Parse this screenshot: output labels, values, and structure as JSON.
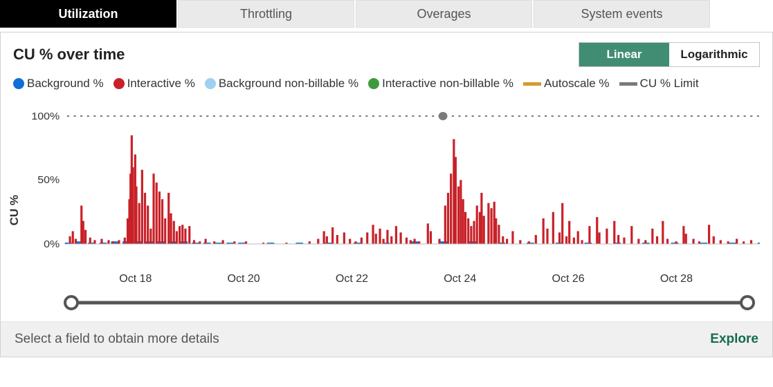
{
  "tabs": [
    {
      "label": "Utilization",
      "active": true
    },
    {
      "label": "Throttling",
      "active": false
    },
    {
      "label": "Overages",
      "active": false
    },
    {
      "label": "System events",
      "active": false
    }
  ],
  "chart_title": "CU % over time",
  "scale_toggle": {
    "linear": "Linear",
    "log": "Logarithmic",
    "active": "linear"
  },
  "legend": [
    {
      "name": "Background %",
      "type": "dot",
      "color": "#0f6fd6"
    },
    {
      "name": "Interactive %",
      "type": "dot",
      "color": "#c82128"
    },
    {
      "name": "Background non-billable %",
      "type": "dot",
      "color": "#9fd0f2"
    },
    {
      "name": "Interactive non-billable %",
      "type": "dot",
      "color": "#3f9a3f"
    },
    {
      "name": "Autoscale %",
      "type": "line",
      "color": "#d69a2f"
    },
    {
      "name": "CU % Limit",
      "type": "line",
      "color": "#7a7a7a"
    }
  ],
  "yaxis_label": "CU %",
  "yticks": [
    "0%",
    "50%",
    "100%"
  ],
  "xticks": [
    "Oct 18",
    "Oct 20",
    "Oct 22",
    "Oct 24",
    "Oct 26",
    "Oct 28"
  ],
  "footer_text": "Select a field to obtain more details",
  "explore_label": "Explore",
  "chart_data": {
    "type": "bar",
    "title": "CU % over time",
    "xlabel": "",
    "ylabel": "CU %",
    "ylim": [
      0,
      100
    ],
    "cu_limit": 100,
    "x_range": [
      "Oct 17",
      "Oct 29"
    ],
    "xticks": [
      "Oct 18",
      "Oct 20",
      "Oct 22",
      "Oct 24",
      "Oct 26",
      "Oct 28"
    ],
    "series": [
      {
        "name": "Background %",
        "color": "#0f6fd6",
        "note": "near-zero baseline across full range, ≤2%",
        "interactive_values": [
          {
            "x": 17.0,
            "v": 1
          },
          {
            "x": 17.2,
            "v": 2
          },
          {
            "x": 17.4,
            "v": 1
          },
          {
            "x": 17.6,
            "v": 1
          },
          {
            "x": 17.8,
            "v": 2
          },
          {
            "x": 18.0,
            "v": 2
          },
          {
            "x": 18.2,
            "v": 2
          },
          {
            "x": 18.4,
            "v": 2
          },
          {
            "x": 18.6,
            "v": 2
          },
          {
            "x": 18.8,
            "v": 2
          },
          {
            "x": 19.0,
            "v": 2
          },
          {
            "x": 19.2,
            "v": 1
          },
          {
            "x": 19.4,
            "v": 1
          },
          {
            "x": 19.6,
            "v": 1
          },
          {
            "x": 19.8,
            "v": 1
          },
          {
            "x": 20.0,
            "v": 1
          },
          {
            "x": 20.5,
            "v": 1
          },
          {
            "x": 21.0,
            "v": 1
          },
          {
            "x": 21.5,
            "v": 1
          },
          {
            "x": 22.0,
            "v": 1
          },
          {
            "x": 22.5,
            "v": 1
          },
          {
            "x": 23.0,
            "v": 2
          },
          {
            "x": 23.5,
            "v": 2
          },
          {
            "x": 24.0,
            "v": 2
          },
          {
            "x": 24.5,
            "v": 1
          },
          {
            "x": 25.0,
            "v": 1
          },
          {
            "x": 25.5,
            "v": 1
          },
          {
            "x": 26.0,
            "v": 1
          },
          {
            "x": 26.5,
            "v": 1
          },
          {
            "x": 27.0,
            "v": 1
          },
          {
            "x": 27.5,
            "v": 1
          },
          {
            "x": 28.0,
            "v": 1
          },
          {
            "x": 28.5,
            "v": 1
          },
          {
            "x": 29.0,
            "v": 1
          }
        ]
      },
      {
        "name": "Interactive %",
        "color": "#c82128",
        "interactive_values": [
          {
            "x": 17.05,
            "v": 6
          },
          {
            "x": 17.1,
            "v": 10
          },
          {
            "x": 17.15,
            "v": 4
          },
          {
            "x": 17.25,
            "v": 30
          },
          {
            "x": 17.28,
            "v": 18
          },
          {
            "x": 17.32,
            "v": 11
          },
          {
            "x": 17.4,
            "v": 5
          },
          {
            "x": 17.48,
            "v": 3
          },
          {
            "x": 17.6,
            "v": 4
          },
          {
            "x": 17.72,
            "v": 3
          },
          {
            "x": 17.8,
            "v": 2
          },
          {
            "x": 17.9,
            "v": 3
          },
          {
            "x": 18.0,
            "v": 5
          },
          {
            "x": 18.05,
            "v": 20
          },
          {
            "x": 18.08,
            "v": 35
          },
          {
            "x": 18.1,
            "v": 55
          },
          {
            "x": 18.12,
            "v": 85
          },
          {
            "x": 18.14,
            "v": 60
          },
          {
            "x": 18.18,
            "v": 70
          },
          {
            "x": 18.2,
            "v": 45
          },
          {
            "x": 18.25,
            "v": 32
          },
          {
            "x": 18.3,
            "v": 58
          },
          {
            "x": 18.35,
            "v": 40
          },
          {
            "x": 18.4,
            "v": 30
          },
          {
            "x": 18.45,
            "v": 12
          },
          {
            "x": 18.5,
            "v": 55
          },
          {
            "x": 18.55,
            "v": 48
          },
          {
            "x": 18.6,
            "v": 41
          },
          {
            "x": 18.65,
            "v": 35
          },
          {
            "x": 18.7,
            "v": 20
          },
          {
            "x": 18.76,
            "v": 40
          },
          {
            "x": 18.8,
            "v": 24
          },
          {
            "x": 18.85,
            "v": 18
          },
          {
            "x": 18.9,
            "v": 10
          },
          {
            "x": 18.95,
            "v": 14
          },
          {
            "x": 19.0,
            "v": 15
          },
          {
            "x": 19.05,
            "v": 12
          },
          {
            "x": 19.12,
            "v": 14
          },
          {
            "x": 19.2,
            "v": 3
          },
          {
            "x": 19.3,
            "v": 2
          },
          {
            "x": 19.4,
            "v": 4
          },
          {
            "x": 19.55,
            "v": 2
          },
          {
            "x": 19.7,
            "v": 3
          },
          {
            "x": 19.9,
            "v": 2
          },
          {
            "x": 20.1,
            "v": 2
          },
          {
            "x": 20.4,
            "v": 1
          },
          {
            "x": 20.8,
            "v": 1
          },
          {
            "x": 21.2,
            "v": 2
          },
          {
            "x": 21.35,
            "v": 4
          },
          {
            "x": 21.45,
            "v": 10
          },
          {
            "x": 21.5,
            "v": 6
          },
          {
            "x": 21.6,
            "v": 13
          },
          {
            "x": 21.68,
            "v": 7
          },
          {
            "x": 21.8,
            "v": 9
          },
          {
            "x": 21.9,
            "v": 4
          },
          {
            "x": 22.0,
            "v": 2
          },
          {
            "x": 22.1,
            "v": 5
          },
          {
            "x": 22.2,
            "v": 9
          },
          {
            "x": 22.3,
            "v": 15
          },
          {
            "x": 22.35,
            "v": 8
          },
          {
            "x": 22.42,
            "v": 12
          },
          {
            "x": 22.48,
            "v": 4
          },
          {
            "x": 22.55,
            "v": 11
          },
          {
            "x": 22.62,
            "v": 6
          },
          {
            "x": 22.7,
            "v": 14
          },
          {
            "x": 22.78,
            "v": 9
          },
          {
            "x": 22.88,
            "v": 5
          },
          {
            "x": 22.95,
            "v": 3
          },
          {
            "x": 23.02,
            "v": 4
          },
          {
            "x": 23.1,
            "v": 2
          },
          {
            "x": 23.25,
            "v": 16
          },
          {
            "x": 23.3,
            "v": 10
          },
          {
            "x": 23.45,
            "v": 4
          },
          {
            "x": 23.55,
            "v": 30
          },
          {
            "x": 23.6,
            "v": 40
          },
          {
            "x": 23.65,
            "v": 55
          },
          {
            "x": 23.7,
            "v": 82
          },
          {
            "x": 23.73,
            "v": 68
          },
          {
            "x": 23.78,
            "v": 45
          },
          {
            "x": 23.82,
            "v": 50
          },
          {
            "x": 23.86,
            "v": 35
          },
          {
            "x": 23.9,
            "v": 25
          },
          {
            "x": 23.95,
            "v": 20
          },
          {
            "x": 24.0,
            "v": 14
          },
          {
            "x": 24.05,
            "v": 18
          },
          {
            "x": 24.1,
            "v": 30
          },
          {
            "x": 24.15,
            "v": 25
          },
          {
            "x": 24.18,
            "v": 40
          },
          {
            "x": 24.22,
            "v": 22
          },
          {
            "x": 24.3,
            "v": 32
          },
          {
            "x": 24.35,
            "v": 28
          },
          {
            "x": 24.4,
            "v": 33
          },
          {
            "x": 24.43,
            "v": 20
          },
          {
            "x": 24.48,
            "v": 15
          },
          {
            "x": 24.55,
            "v": 6
          },
          {
            "x": 24.62,
            "v": 4
          },
          {
            "x": 24.72,
            "v": 10
          },
          {
            "x": 24.85,
            "v": 3
          },
          {
            "x": 25.0,
            "v": 2
          },
          {
            "x": 25.12,
            "v": 7
          },
          {
            "x": 25.25,
            "v": 20
          },
          {
            "x": 25.32,
            "v": 12
          },
          {
            "x": 25.42,
            "v": 25
          },
          {
            "x": 25.53,
            "v": 9
          },
          {
            "x": 25.58,
            "v": 32
          },
          {
            "x": 25.65,
            "v": 6
          },
          {
            "x": 25.7,
            "v": 18
          },
          {
            "x": 25.78,
            "v": 5
          },
          {
            "x": 25.85,
            "v": 10
          },
          {
            "x": 25.92,
            "v": 3
          },
          {
            "x": 26.05,
            "v": 14
          },
          {
            "x": 26.18,
            "v": 21
          },
          {
            "x": 26.22,
            "v": 9
          },
          {
            "x": 26.35,
            "v": 12
          },
          {
            "x": 26.48,
            "v": 18
          },
          {
            "x": 26.55,
            "v": 7
          },
          {
            "x": 26.65,
            "v": 5
          },
          {
            "x": 26.78,
            "v": 14
          },
          {
            "x": 26.9,
            "v": 4
          },
          {
            "x": 27.02,
            "v": 3
          },
          {
            "x": 27.14,
            "v": 12
          },
          {
            "x": 27.22,
            "v": 6
          },
          {
            "x": 27.32,
            "v": 18
          },
          {
            "x": 27.4,
            "v": 4
          },
          {
            "x": 27.55,
            "v": 2
          },
          {
            "x": 27.68,
            "v": 14
          },
          {
            "x": 27.72,
            "v": 8
          },
          {
            "x": 27.85,
            "v": 4
          },
          {
            "x": 27.95,
            "v": 2
          },
          {
            "x": 28.12,
            "v": 15
          },
          {
            "x": 28.2,
            "v": 6
          },
          {
            "x": 28.32,
            "v": 3
          },
          {
            "x": 28.45,
            "v": 2
          },
          {
            "x": 28.6,
            "v": 4
          },
          {
            "x": 28.72,
            "v": 2
          },
          {
            "x": 28.85,
            "v": 3
          }
        ]
      },
      {
        "name": "Background non-billable %",
        "color": "#9fd0f2",
        "note": "no visible data"
      },
      {
        "name": "Interactive non-billable %",
        "color": "#3f9a3f",
        "note": "no visible data"
      },
      {
        "name": "Autoscale %",
        "color": "#d69a2f",
        "note": "line series, not visibly drawn"
      },
      {
        "name": "CU % Limit",
        "color": "#7a7a7a",
        "constant": 100
      }
    ]
  }
}
